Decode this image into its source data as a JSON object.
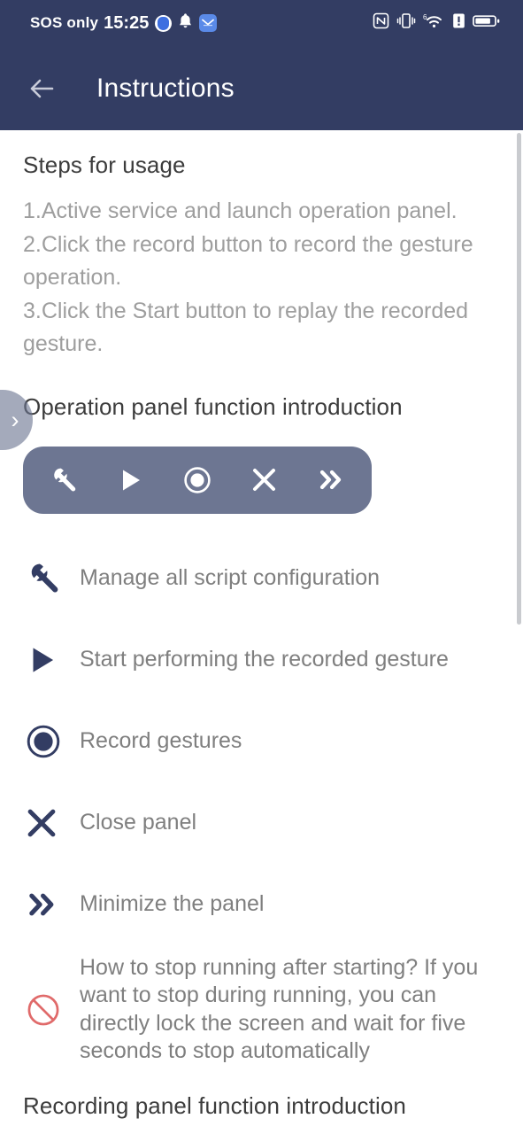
{
  "statusbar": {
    "carrier": "SOS only",
    "time": "15:25",
    "left_icons": [
      "shield-badge-icon",
      "bell-icon",
      "mail-icon"
    ],
    "right_icons": [
      "nfc-icon",
      "vibrate-icon",
      "wifi-6-icon",
      "sim-alert-icon",
      "battery-icon"
    ],
    "background": "#333d63"
  },
  "appbar": {
    "back_label": "",
    "title": "Instructions",
    "background": "#333d63",
    "title_color": "#ffffff"
  },
  "sections": {
    "steps_heading": "Steps for usage",
    "steps": [
      "1.Active service and launch operation panel.",
      "2.Click the record button to record the gesture operation.",
      "3.Click the Start button to replay the recorded gesture."
    ],
    "panel_heading": "Operation panel function introduction",
    "recording_heading": "Recording panel function introduction"
  },
  "operation_panel": {
    "background": "#6d7692",
    "icon_color": "#ffffff",
    "buttons": [
      {
        "name": "wrench-icon",
        "label": "Manage all script configuration"
      },
      {
        "name": "play-icon",
        "label": "Start performing the recorded gesture"
      },
      {
        "name": "record-icon",
        "label": "Record gestures"
      },
      {
        "name": "close-icon",
        "label": "Close panel"
      },
      {
        "name": "minimize-icon",
        "label": "Minimize the panel"
      }
    ]
  },
  "legend": [
    {
      "icon": "wrench-icon",
      "text": "Manage all script configuration",
      "color": "#333d63"
    },
    {
      "icon": "play-icon",
      "text": "Start performing the recorded gesture",
      "color": "#333d63"
    },
    {
      "icon": "record-icon",
      "text": "Record gestures",
      "color": "#333d63"
    },
    {
      "icon": "close-icon",
      "text": "Close panel",
      "color": "#333d63"
    },
    {
      "icon": "minimize-icon",
      "text": "Minimize the panel",
      "color": "#333d63"
    },
    {
      "icon": "prohibited-icon",
      "text": "How to stop running after starting? If you want to stop during running, you can directly lock the screen and wait for five seconds to stop automatically",
      "color": "#e06a6a"
    }
  ],
  "edge_handle": {
    "chevron": "›",
    "background": "rgba(108,118,146,.62)"
  },
  "scrollbar": {
    "thumb_color": "#c9cbcf"
  },
  "colors": {
    "accent_navy": "#333d63",
    "panel_grey": "#6d7692",
    "body_text": "#7f7f7f",
    "muted_text": "#9e9e9e",
    "heading_text": "#3c3c3c",
    "warn_red": "#e06a6a"
  }
}
